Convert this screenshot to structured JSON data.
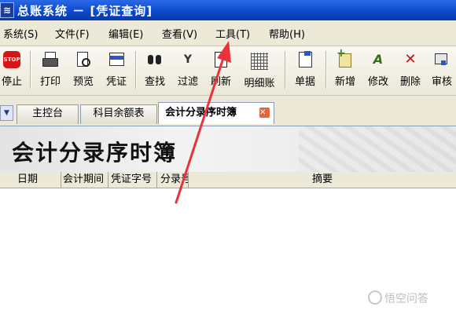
{
  "window": {
    "title": "总账系统 － [凭证查询]",
    "icon": "app-logo-icon"
  },
  "menu": [
    {
      "label": "系统(S)"
    },
    {
      "label": "文件(F)"
    },
    {
      "label": "编辑(E)"
    },
    {
      "label": "查看(V)"
    },
    {
      "label": "工具(T)"
    },
    {
      "label": "帮助(H)"
    }
  ],
  "toolbar": [
    {
      "label": "停止",
      "icon": "stop-icon",
      "glyph": "STOP"
    },
    {
      "label": "打印",
      "icon": "printer-icon"
    },
    {
      "label": "预览",
      "icon": "preview-icon"
    },
    {
      "label": "凭证",
      "icon": "voucher-icon"
    },
    {
      "label": "查找",
      "icon": "binoculars-icon"
    },
    {
      "label": "过滤",
      "icon": "filter-icon",
      "glyph": "Y"
    },
    {
      "label": "刷新",
      "icon": "refresh-icon"
    },
    {
      "label": "明细账",
      "icon": "ledger-grid-icon"
    },
    {
      "label": "单据",
      "icon": "document-icon"
    },
    {
      "label": "新增",
      "icon": "add-icon"
    },
    {
      "label": "修改",
      "icon": "edit-icon",
      "glyph": "A"
    },
    {
      "label": "删除",
      "icon": "delete-icon",
      "glyph": "✕"
    },
    {
      "label": "审核",
      "icon": "audit-icon"
    }
  ],
  "tabs": [
    {
      "label": "主控台",
      "active": false
    },
    {
      "label": "科目余额表",
      "active": false
    },
    {
      "label": "会计分录序时簿",
      "active": true
    }
  ],
  "tab_nav": {
    "glyph": "▼"
  },
  "tab_close": {
    "glyph": "✕"
  },
  "page": {
    "title": "会计分录序时簿"
  },
  "grid": {
    "columns": [
      "日期",
      "会计期间",
      "凭证字号",
      "分录号",
      "摘要"
    ],
    "rows": []
  },
  "annotation": {
    "arrow_color": "#e8333a"
  },
  "watermark": {
    "text": "悟空问答"
  },
  "colors": {
    "titlebar": "#0a47c9",
    "menubar": "#ece9d8",
    "active_tab_close": "#e8643a"
  }
}
